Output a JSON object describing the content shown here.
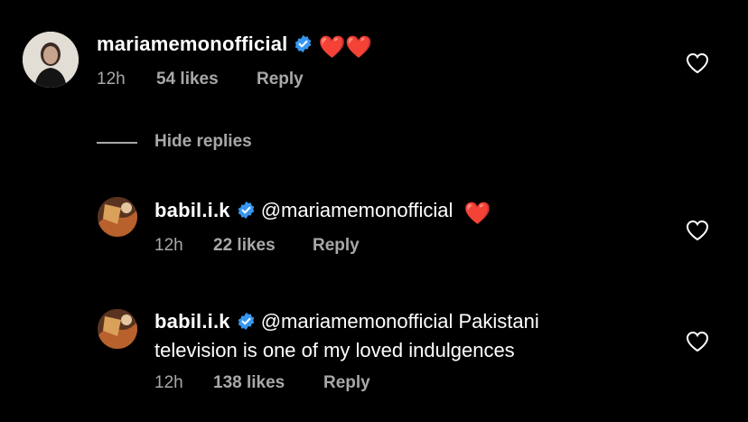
{
  "comment": {
    "username": "mariamemonofficial",
    "text_emoji": "❤️❤️",
    "time": "12h",
    "likes": "54 likes",
    "reply_label": "Reply"
  },
  "hide_replies_label": "Hide replies",
  "replies": [
    {
      "username": "babil.i.k",
      "mention": "@mariamemonofficial",
      "text_line1": "",
      "text_line2": "",
      "emoji": "❤️",
      "time": "12h",
      "likes": "22 likes",
      "reply_label": "Reply"
    },
    {
      "username": "babil.i.k",
      "mention": "@mariamemonofficial",
      "text_line1": " Pakistani",
      "text_line2": "television is one of my loved indulgences",
      "time": "12h",
      "likes": "138 likes",
      "reply_label": "Reply"
    }
  ],
  "colors": {
    "background": "#000000",
    "text": "#ffffff",
    "secondary_text": "#a8a8a8",
    "verified_badge": "#3797f0",
    "heart_emoji": "#e8202f"
  },
  "icons": {
    "verified": "verified-badge-icon",
    "like": "heart-outline-icon"
  }
}
